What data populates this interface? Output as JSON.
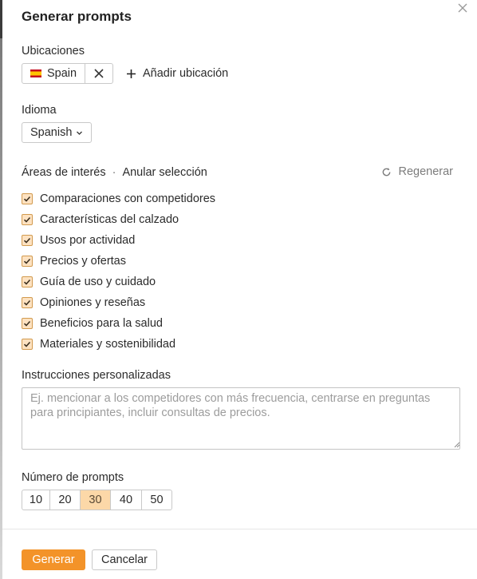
{
  "dialog": {
    "title": "Generar prompts"
  },
  "locations": {
    "label": "Ubicaciones",
    "chips": [
      {
        "flag": "spain-flag-icon",
        "name": "Spain"
      }
    ],
    "add_label": "Añadir ubicación"
  },
  "language": {
    "label": "Idioma",
    "selected": "Spanish"
  },
  "interests": {
    "label": "Áreas de interés",
    "separator": "·",
    "clear_label": "Anular selección",
    "regenerate_label": "Regenerar",
    "items": [
      {
        "label": "Comparaciones con competidores",
        "checked": true
      },
      {
        "label": "Características del calzado",
        "checked": true
      },
      {
        "label": "Usos por actividad",
        "checked": true
      },
      {
        "label": "Precios y ofertas",
        "checked": true
      },
      {
        "label": "Guía de uso y cuidado",
        "checked": true
      },
      {
        "label": "Opiniones y reseñas",
        "checked": true
      },
      {
        "label": "Beneficios para la salud",
        "checked": true
      },
      {
        "label": "Materiales y sostenibilidad",
        "checked": true
      }
    ]
  },
  "custom_instructions": {
    "label": "Instrucciones personalizadas",
    "value": "",
    "placeholder": "Ej. mencionar a los competidores con más frecuencia, centrarse en preguntas para principiantes, incluir consultas de precios."
  },
  "prompt_count": {
    "label": "Número de prompts",
    "options": [
      "10",
      "20",
      "30",
      "40",
      "50"
    ],
    "selected": "30"
  },
  "footer": {
    "generate_label": "Generar",
    "cancel_label": "Cancelar"
  },
  "colors": {
    "accent": "#f39329",
    "accent_light": "#fcd8a8",
    "checkbox_fill": "#fde2c1"
  }
}
